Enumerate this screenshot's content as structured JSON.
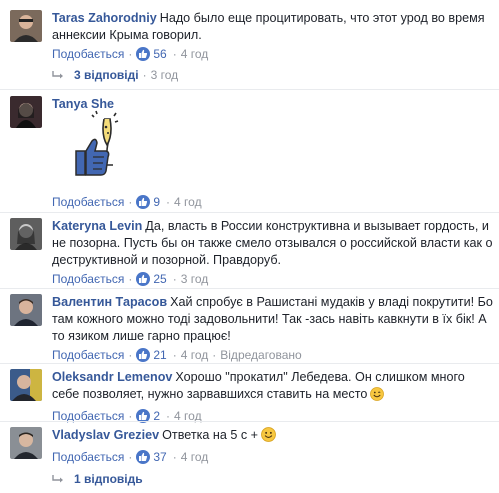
{
  "comments": [
    {
      "author": "Taras Zahorodniy",
      "text": "Надо было еще процитировать, что этот урод во время аннексии Крыма говорил.",
      "like_label": "Подобається",
      "likes": "56",
      "time": "4 год"
    },
    {
      "author": "Tanya She",
      "text": "",
      "like_label": "Подобається",
      "likes": "9",
      "time": "4 год"
    },
    {
      "author": "Kateryna Levin",
      "text": "Да, власть в России конструктивна и вызывает гордость, и не позорна. Пусть бы он также смело отзывался о российской власти как о деструктивной и позорной. Правдоруб.",
      "like_label": "Подобається",
      "likes": "25",
      "time": "3 год"
    },
    {
      "author": "Валентин Тарасов",
      "text": "Хай спробує в Рашистані мудаків у владі покрутити! Бо там кожного можно тоді задовольнити! Так -зась навіть кавкнути в їх бік! А то язиком лише гарно працює!",
      "like_label": "Подобається",
      "likes": "21",
      "time": "4 год",
      "edited": "Відредаговано"
    },
    {
      "author": "Oleksandr Lemenov",
      "text": "Хорошо \"прокатил\" Лебедева. Он слишком много себе позволяет, нужно зарвавшихся ставить на место",
      "like_label": "Подобається",
      "likes": "2",
      "time": "4 год"
    },
    {
      "author": "Vladyslav Greziev",
      "text": "Ответка на 5 с +",
      "like_label": "Подобається",
      "likes": "37",
      "time": "4 год"
    }
  ],
  "replies": [
    {
      "label": "3 відповіді",
      "time": "3 год"
    },
    {
      "label": "1 відповідь"
    }
  ],
  "colors": {
    "link": "#365899",
    "meta": "#90949c",
    "like_badge": "#4a76c8"
  },
  "icons": [
    "like-thumb-icon",
    "reply-arrow-icon",
    "smile-emoji-icon",
    "champagne-like-sticker"
  ]
}
